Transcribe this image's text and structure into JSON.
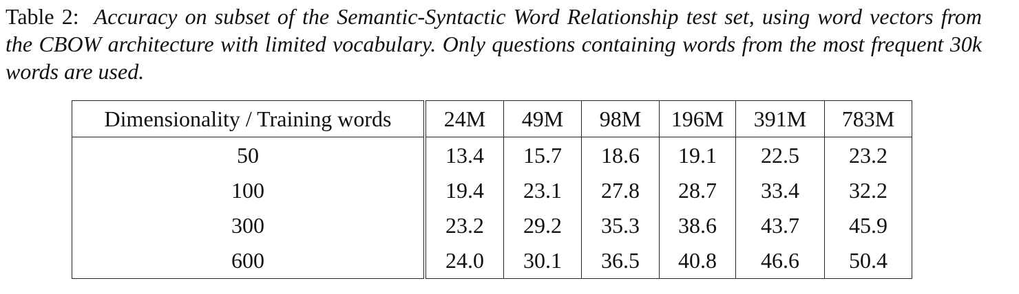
{
  "caption": {
    "label": "Table 2:",
    "text": "Accuracy on subset of the Semantic-Syntactic Word Relationship test set, using word vectors from the CBOW architecture with limited vocabulary. Only questions containing words from the most frequent 30k words are used."
  },
  "table": {
    "header": [
      "Dimensionality / Training words",
      "24M",
      "49M",
      "98M",
      "196M",
      "391M",
      "783M"
    ],
    "rows": [
      [
        "50",
        "13.4",
        "15.7",
        "18.6",
        "19.1",
        "22.5",
        "23.2"
      ],
      [
        "100",
        "19.4",
        "23.1",
        "27.8",
        "28.7",
        "33.4",
        "32.2"
      ],
      [
        "300",
        "23.2",
        "29.2",
        "35.3",
        "38.6",
        "43.7",
        "45.9"
      ],
      [
        "600",
        "24.0",
        "30.1",
        "36.5",
        "40.8",
        "46.6",
        "50.4"
      ]
    ]
  }
}
